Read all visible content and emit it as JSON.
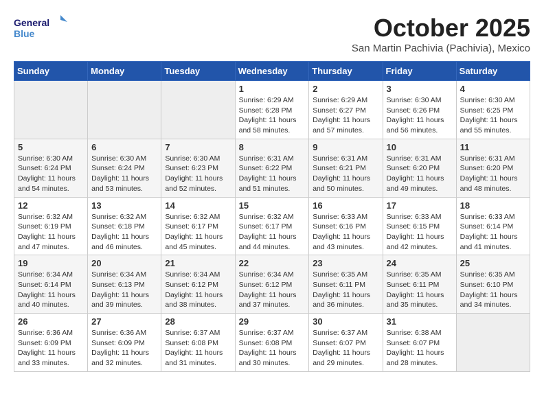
{
  "logo": {
    "line1": "General",
    "line2": "Blue"
  },
  "title": "October 2025",
  "location": "San Martin Pachivia (Pachivia), Mexico",
  "days_of_week": [
    "Sunday",
    "Monday",
    "Tuesday",
    "Wednesday",
    "Thursday",
    "Friday",
    "Saturday"
  ],
  "weeks": [
    [
      {
        "day": "",
        "info": ""
      },
      {
        "day": "",
        "info": ""
      },
      {
        "day": "",
        "info": ""
      },
      {
        "day": "1",
        "info": "Sunrise: 6:29 AM\nSunset: 6:28 PM\nDaylight: 11 hours and 58 minutes."
      },
      {
        "day": "2",
        "info": "Sunrise: 6:29 AM\nSunset: 6:27 PM\nDaylight: 11 hours and 57 minutes."
      },
      {
        "day": "3",
        "info": "Sunrise: 6:30 AM\nSunset: 6:26 PM\nDaylight: 11 hours and 56 minutes."
      },
      {
        "day": "4",
        "info": "Sunrise: 6:30 AM\nSunset: 6:25 PM\nDaylight: 11 hours and 55 minutes."
      }
    ],
    [
      {
        "day": "5",
        "info": "Sunrise: 6:30 AM\nSunset: 6:24 PM\nDaylight: 11 hours and 54 minutes."
      },
      {
        "day": "6",
        "info": "Sunrise: 6:30 AM\nSunset: 6:24 PM\nDaylight: 11 hours and 53 minutes."
      },
      {
        "day": "7",
        "info": "Sunrise: 6:30 AM\nSunset: 6:23 PM\nDaylight: 11 hours and 52 minutes."
      },
      {
        "day": "8",
        "info": "Sunrise: 6:31 AM\nSunset: 6:22 PM\nDaylight: 11 hours and 51 minutes."
      },
      {
        "day": "9",
        "info": "Sunrise: 6:31 AM\nSunset: 6:21 PM\nDaylight: 11 hours and 50 minutes."
      },
      {
        "day": "10",
        "info": "Sunrise: 6:31 AM\nSunset: 6:20 PM\nDaylight: 11 hours and 49 minutes."
      },
      {
        "day": "11",
        "info": "Sunrise: 6:31 AM\nSunset: 6:20 PM\nDaylight: 11 hours and 48 minutes."
      }
    ],
    [
      {
        "day": "12",
        "info": "Sunrise: 6:32 AM\nSunset: 6:19 PM\nDaylight: 11 hours and 47 minutes."
      },
      {
        "day": "13",
        "info": "Sunrise: 6:32 AM\nSunset: 6:18 PM\nDaylight: 11 hours and 46 minutes."
      },
      {
        "day": "14",
        "info": "Sunrise: 6:32 AM\nSunset: 6:17 PM\nDaylight: 11 hours and 45 minutes."
      },
      {
        "day": "15",
        "info": "Sunrise: 6:32 AM\nSunset: 6:17 PM\nDaylight: 11 hours and 44 minutes."
      },
      {
        "day": "16",
        "info": "Sunrise: 6:33 AM\nSunset: 6:16 PM\nDaylight: 11 hours and 43 minutes."
      },
      {
        "day": "17",
        "info": "Sunrise: 6:33 AM\nSunset: 6:15 PM\nDaylight: 11 hours and 42 minutes."
      },
      {
        "day": "18",
        "info": "Sunrise: 6:33 AM\nSunset: 6:14 PM\nDaylight: 11 hours and 41 minutes."
      }
    ],
    [
      {
        "day": "19",
        "info": "Sunrise: 6:34 AM\nSunset: 6:14 PM\nDaylight: 11 hours and 40 minutes."
      },
      {
        "day": "20",
        "info": "Sunrise: 6:34 AM\nSunset: 6:13 PM\nDaylight: 11 hours and 39 minutes."
      },
      {
        "day": "21",
        "info": "Sunrise: 6:34 AM\nSunset: 6:12 PM\nDaylight: 11 hours and 38 minutes."
      },
      {
        "day": "22",
        "info": "Sunrise: 6:34 AM\nSunset: 6:12 PM\nDaylight: 11 hours and 37 minutes."
      },
      {
        "day": "23",
        "info": "Sunrise: 6:35 AM\nSunset: 6:11 PM\nDaylight: 11 hours and 36 minutes."
      },
      {
        "day": "24",
        "info": "Sunrise: 6:35 AM\nSunset: 6:11 PM\nDaylight: 11 hours and 35 minutes."
      },
      {
        "day": "25",
        "info": "Sunrise: 6:35 AM\nSunset: 6:10 PM\nDaylight: 11 hours and 34 minutes."
      }
    ],
    [
      {
        "day": "26",
        "info": "Sunrise: 6:36 AM\nSunset: 6:09 PM\nDaylight: 11 hours and 33 minutes."
      },
      {
        "day": "27",
        "info": "Sunrise: 6:36 AM\nSunset: 6:09 PM\nDaylight: 11 hours and 32 minutes."
      },
      {
        "day": "28",
        "info": "Sunrise: 6:37 AM\nSunset: 6:08 PM\nDaylight: 11 hours and 31 minutes."
      },
      {
        "day": "29",
        "info": "Sunrise: 6:37 AM\nSunset: 6:08 PM\nDaylight: 11 hours and 30 minutes."
      },
      {
        "day": "30",
        "info": "Sunrise: 6:37 AM\nSunset: 6:07 PM\nDaylight: 11 hours and 29 minutes."
      },
      {
        "day": "31",
        "info": "Sunrise: 6:38 AM\nSunset: 6:07 PM\nDaylight: 11 hours and 28 minutes."
      },
      {
        "day": "",
        "info": ""
      }
    ]
  ]
}
